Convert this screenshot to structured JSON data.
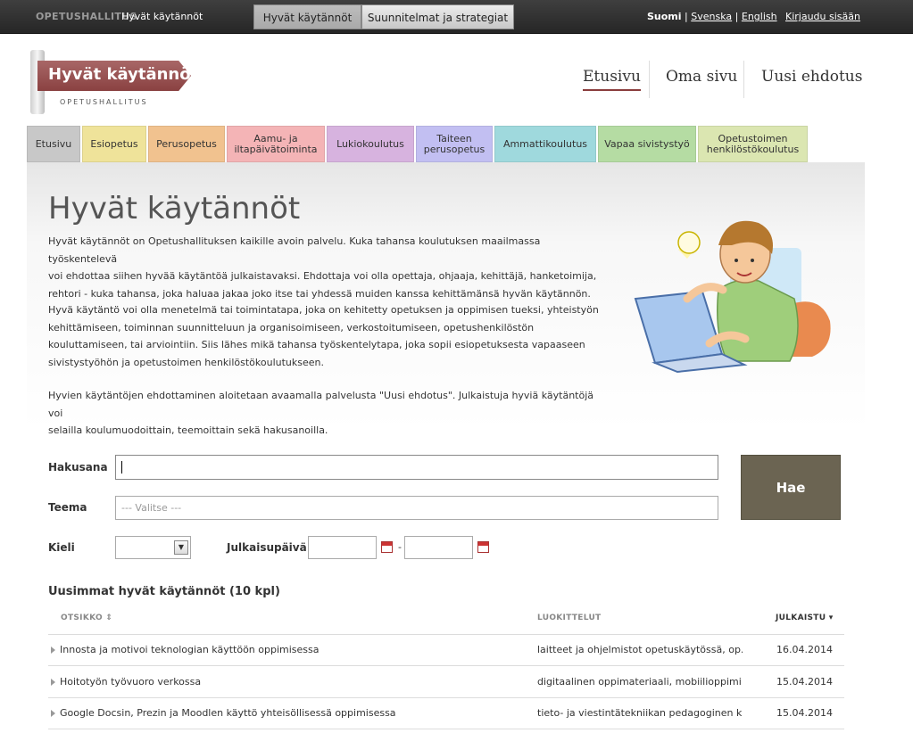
{
  "topbar": {
    "brand": "OPETUSHALLITUS",
    "brand_sub": "Hyvät käytännöt",
    "tabs": [
      "Hyvät käytännöt",
      "Suunnitelmat ja strategiat"
    ],
    "languages": [
      "Suomi",
      "Svenska",
      "English"
    ],
    "language_separator": "|",
    "login": "Kirjaudu sisään"
  },
  "logo": {
    "title": "Hyvät käytännöt",
    "org": "OPETUSHALLITUS"
  },
  "mainnav": [
    "Etusivu",
    "Oma sivu",
    "Uusi ehdotus"
  ],
  "categories": [
    {
      "label": "Etusivu",
      "color": "#c8c8c8"
    },
    {
      "label": "Esiopetus",
      "color": "#efe39a"
    },
    {
      "label": "Perusopetus",
      "color": "#f1c28f"
    },
    {
      "label": "Aamu- ja iltapäivätoiminta",
      "color": "#f4b4b6"
    },
    {
      "label": "Lukiokoulutus",
      "color": "#d7b3df"
    },
    {
      "label": "Taiteen perusopetus",
      "color": "#c2bff2"
    },
    {
      "label": "Ammattikoulutus",
      "color": "#9fd9dd"
    },
    {
      "label": "Vapaa sivistystyö",
      "color": "#b5dca3"
    },
    {
      "label": "Opetustoimen henkilöstökoulutus",
      "color": "#dbe6b1"
    }
  ],
  "hero": {
    "title": "Hyvät käytännöt",
    "paragraphs": [
      [
        "Hyvät käytännöt on Opetushallituksen kaikille avoin palvelu. Kuka tahansa koulutuksen maailmassa työskentelevä",
        "voi ehdottaa siihen hyvää käytäntöä julkaistavaksi. Ehdottaja voi olla opettaja, ohjaaja, kehittäjä, hanketoimija,",
        "rehtori - kuka tahansa, joka haluaa jakaa joko itse tai yhdessä muiden kanssa kehittämänsä hyvän käytännön."
      ],
      [
        "Hyvä käytäntö voi olla menetelmä tai toimintatapa, joka on kehitetty opetuksen ja oppimisen tueksi, yhteistyön",
        "kehittämiseen, toiminnan suunnitteluun ja organisoimiseen, verkostoitumiseen, opetushenkilöstön",
        "kouluttamiseen, tai arviointiin. Siis lähes mikä tahansa työskentelytapa, joka sopii esiopetuksesta vapaaseen",
        "sivistystyöhön ja opetustoimen henkilöstökoulutukseen."
      ],
      [
        "Hyvien käytäntöjen ehdottaminen aloitetaan avaamalla palvelusta \"Uusi ehdotus\". Julkaistuja hyviä käytäntöjä voi",
        "selailla koulumuodoittain, teemoittain sekä hakusanoilla."
      ]
    ]
  },
  "search": {
    "hakusana_label": "Hakusana",
    "hakusana_value": "",
    "teema_label": "Teema",
    "teema_value": "--- Valitse ---",
    "kieli_label": "Kieli",
    "kieli_value": "",
    "julkaisu_label": "Julkaisupäivä",
    "date_from": "",
    "date_to": "",
    "date_separator": "-",
    "submit": "Hae"
  },
  "latest": {
    "title": "Uusimmat hyvät käytännöt (10 kpl)",
    "columns": [
      "OTSIKKO",
      "LUOKITTELUT",
      "JULKAISTU"
    ],
    "sort_asc_glyph": "⇕",
    "sort_desc_glyph": "▾",
    "rows": [
      {
        "title": "Innosta ja motivoi teknologian käyttöön oppimisessa",
        "tags": "laitteet ja ohjelmistot opetuskäytössä, op...",
        "date": "16.04.2014"
      },
      {
        "title": "Hoitotyön työvuoro verkossa",
        "tags": "digitaalinen oppimateriaali, mobiilioppimi...",
        "date": "15.04.2014"
      },
      {
        "title": "Google Docsin, Prezin ja Moodlen käyttö yhteisöllisessä oppimisessa",
        "tags": "tieto- ja viestintätekniikan pedagoginen k...",
        "date": "15.04.2014"
      }
    ]
  }
}
